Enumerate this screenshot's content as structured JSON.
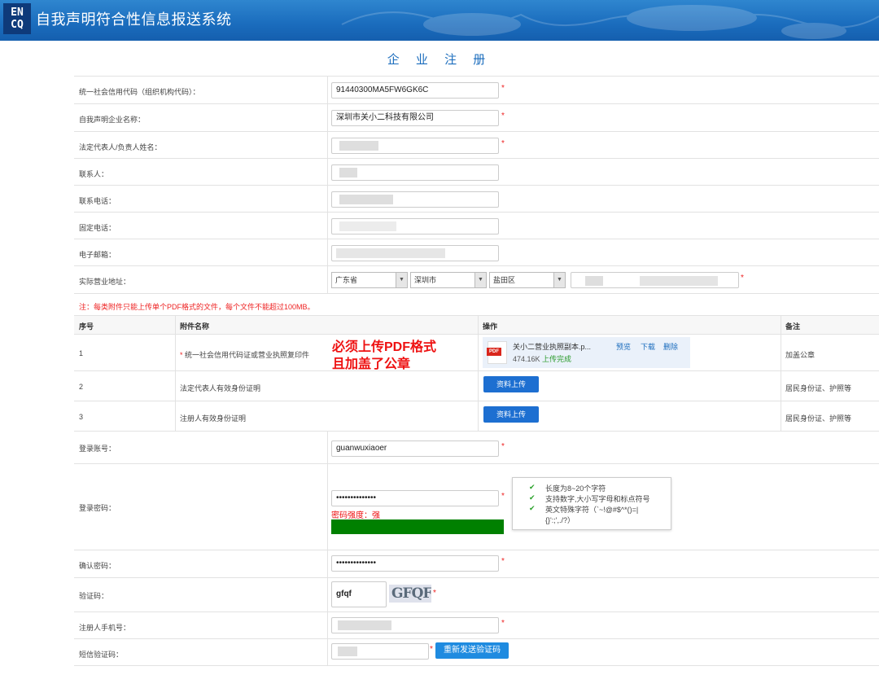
{
  "header": {
    "logo_top": "EN",
    "logo_bottom": "CQ",
    "title": "自我声明符合性信息报送系统"
  },
  "page_title": "企 业 注 册",
  "fields": {
    "credit_code": {
      "label": "统一社会信用代码（组织机构代码）：",
      "value": "91440300MA5FW6GK6C"
    },
    "company_name": {
      "label": "自我声明企业名称：",
      "value": "深圳市关小二科技有限公司"
    },
    "legal_rep": {
      "label": "法定代表人/负责人姓名："
    },
    "contact": {
      "label": "联系人："
    },
    "contact_phone": {
      "label": "联系电话："
    },
    "landline": {
      "label": "固定电话："
    },
    "email": {
      "label": "电子邮箱："
    },
    "address": {
      "label": "实际营业地址：",
      "province": "广东省",
      "city": "深圳市",
      "district": "盐田区"
    },
    "login_account": {
      "label": "登录账号：",
      "value": "guanwuxiaoer"
    },
    "login_password": {
      "label": "登录密码：",
      "value": "••••••••••••••"
    },
    "confirm_password": {
      "label": "确认密码：",
      "value": "••••••••••••••"
    },
    "captcha": {
      "label": "验证码：",
      "value": "gfqf",
      "image_text": "GFQF"
    },
    "mobile": {
      "label": "注册人手机号："
    },
    "sms_code": {
      "label": "短信验证码：",
      "button": "重新发送验证码"
    }
  },
  "required_mark": "*",
  "attachment_note": "注：每类附件只能上传单个PDF格式的文件，每个文件不能超过100MB。",
  "attachments": {
    "headers": {
      "no": "序号",
      "name": "附件名称",
      "action": "操作",
      "remark": "备注"
    },
    "rows": [
      {
        "no": "1",
        "name": "统一社会信用代码证或营业执照复印件",
        "remark": "加盖公章",
        "file": {
          "name": "关小二营业执照副本.p...",
          "size": "474.16K",
          "status": "上传完成",
          "preview": "预览",
          "download": "下载",
          "delete": "删除",
          "icon_label": "PDF"
        }
      },
      {
        "no": "2",
        "name": "法定代表人有效身份证明",
        "remark": "居民身份证、护照等",
        "button": "资料上传"
      },
      {
        "no": "3",
        "name": "注册人有效身份证明",
        "remark": "居民身份证、护照等",
        "button": "资料上传"
      }
    ]
  },
  "annotation": {
    "line1": "必须上传PDF格式",
    "line2": "且加盖了公章"
  },
  "password_hints": {
    "items": [
      "长度为8~20个字符",
      "支持数字,大小写字母和标点符号",
      "英文特殊字符（`~!@#$^*()=|",
      "{}':;',./?）"
    ],
    "check": "✔"
  },
  "password_strength": {
    "label": "密码强度：强",
    "level": 1.0
  },
  "colors": {
    "header": "#1a6cbd",
    "required": "#ee2222",
    "strength_bar": "#008000",
    "upload_button": "#1d6fd1"
  }
}
